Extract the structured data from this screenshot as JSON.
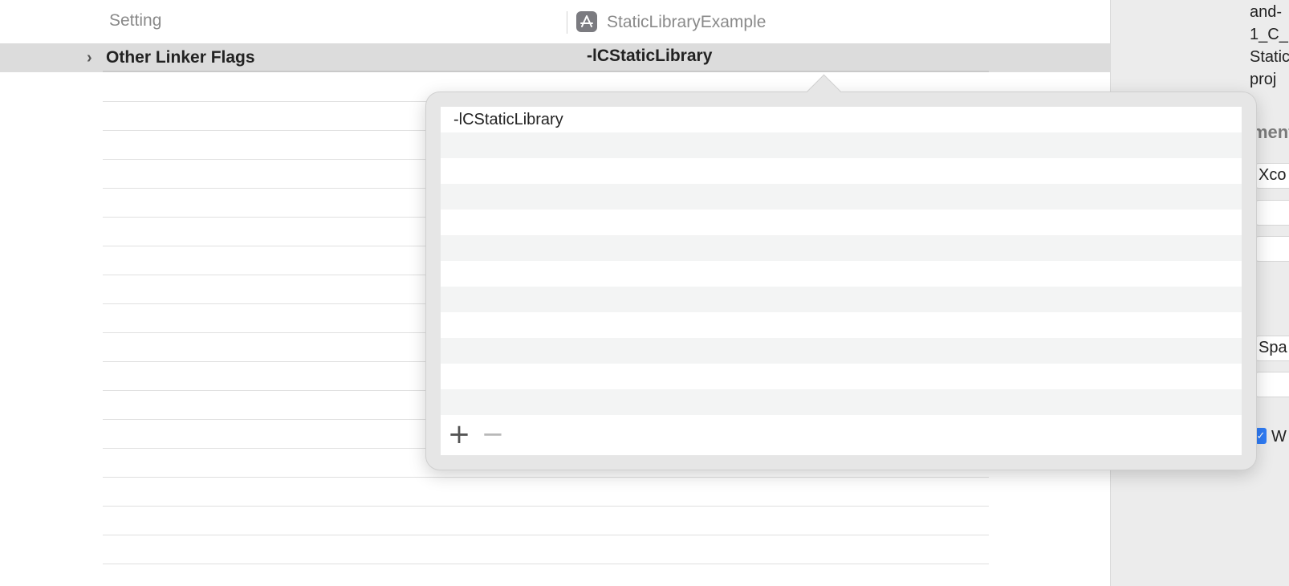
{
  "header": {
    "setting_column": "Setting",
    "target_name": "StaticLibraryExample",
    "target_icon": "app-target-icon"
  },
  "selected_setting": {
    "name": "Other Linker Flags",
    "value": "-lCStaticLibrary"
  },
  "popover": {
    "flags": [
      "-lCStaticLibrary",
      "",
      "",
      "",
      "",
      "",
      "",
      "",
      "",
      "",
      "",
      "",
      ""
    ],
    "add_label": "+",
    "remove_label": "−"
  },
  "inspector": {
    "path_lines": [
      "and-",
      "1_C_",
      "Static",
      "proj"
    ],
    "section_title": "ment",
    "field_1": "Xco",
    "field_2": "Spa",
    "checkbox_label": "W"
  },
  "colors": {
    "selection": "#dcdcdc",
    "accent": "#2f7cf6"
  }
}
